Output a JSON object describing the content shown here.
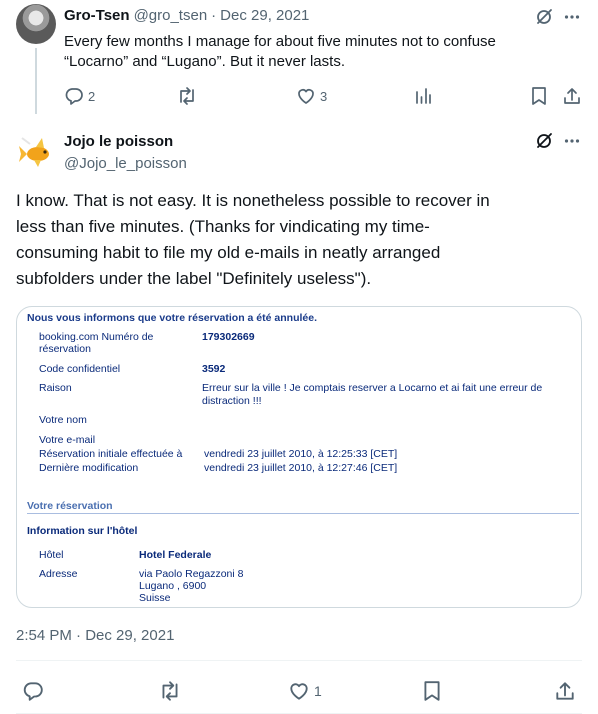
{
  "reply": {
    "name": "Gro-Tsen",
    "handle": "@gro_tsen",
    "separator": "·",
    "date": "Dec 29, 2021",
    "text_line1": "Every few months I manage for about five minutes not to confuse",
    "text_line2": "“Locarno” and “Lugano”. But it never lasts.",
    "replies": "2",
    "likes": "3"
  },
  "main": {
    "name": "Jojo le poisson",
    "handle": "@Jojo_le_poisson",
    "text_line1": "I know. That is not easy. It is nonetheless possible to recover in",
    "text_line2": "less than five minutes. (Thanks for vindicating my time-",
    "text_line3": "consuming habit to file my old e-mails in neatly arranged",
    "text_line4": "subfolders under the label \"Definitely useless\").",
    "timestamp": "2:54 PM · Dec 29, 2021",
    "likes": "1"
  },
  "card": {
    "header": "Nous vous informons que votre réservation a été annulée.",
    "rows": [
      {
        "label": "booking.com Numéro de",
        "label2": "réservation",
        "value": "179302669"
      },
      {
        "label": "Code confidentiel",
        "value": "3592"
      },
      {
        "label": "Raison",
        "value": "Erreur sur la ville ! Je comptais reserver a Locarno et ai fait une erreur de",
        "value2": "distraction !!!"
      },
      {
        "label": "Votre nom",
        "value": ""
      },
      {
        "label": "Votre e-mail",
        "value": ""
      },
      {
        "label": "Réservation initiale effectuée à",
        "value": "vendredi 23 juillet 2010, à 12:25:33 [CET]"
      },
      {
        "label": "Dernière modification",
        "value": "vendredi 23 juillet 2010, à 12:27:46 [CET]"
      }
    ],
    "section_title": "Votre réservation",
    "hotel_header": "Information sur l'hôtel",
    "hotel_label": "Hôtel",
    "hotel_value": "Hotel Federale",
    "address_label": "Adresse",
    "address_line1": "via Paolo Regazzoni 8",
    "address_line2": "Lugano , 6900",
    "address_line3": "Suisse"
  },
  "icons": {
    "grok": "grok-icon",
    "more": "more-icon",
    "reply": "reply-icon",
    "retweet": "retweet-icon",
    "like": "heart-icon",
    "views": "views-icon",
    "bookmark": "bookmark-icon",
    "share": "share-icon"
  },
  "colors": {
    "text": "#0f1419",
    "muted": "#536471",
    "border": "#cfd9de",
    "booking_blue": "#0a2a7a"
  }
}
